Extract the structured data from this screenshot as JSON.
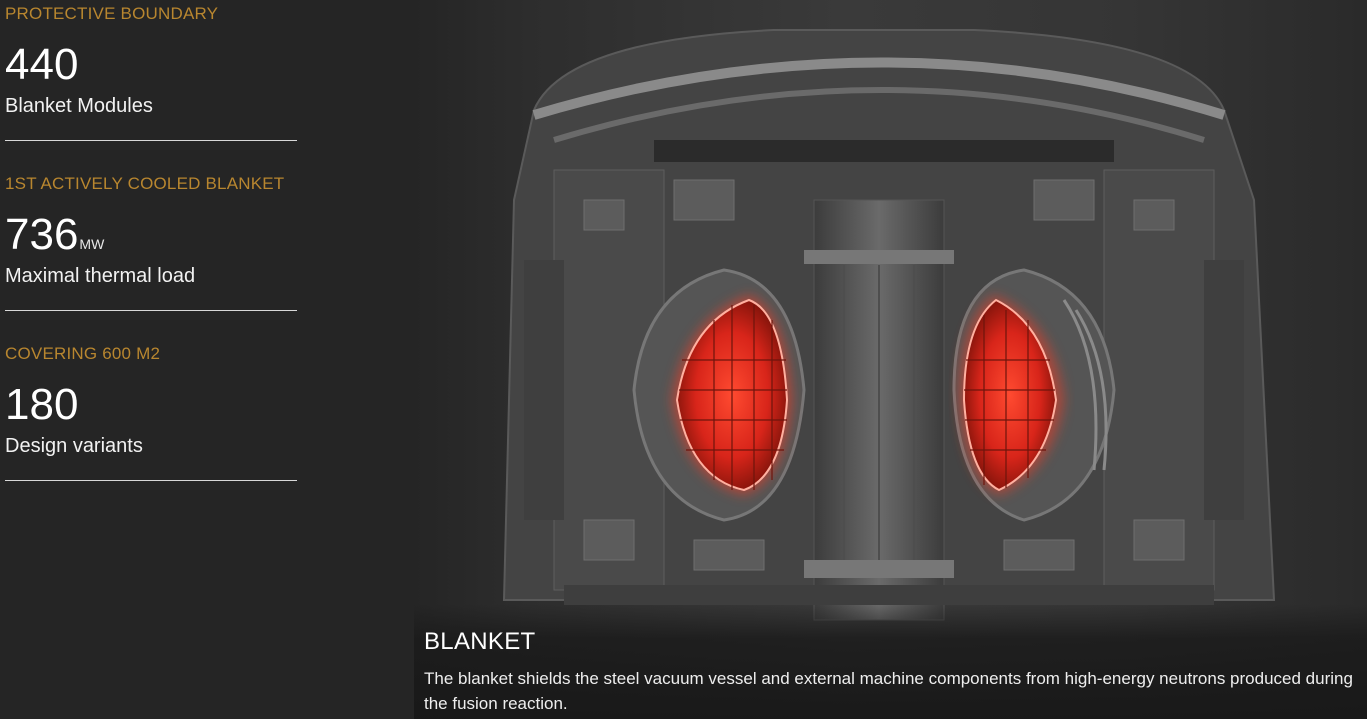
{
  "stats": [
    {
      "kicker": "PROTECTIVE BOUNDARY",
      "value": "440",
      "unit": "",
      "label": "Blanket Modules"
    },
    {
      "kicker": "1ST ACTIVELY COOLED BLANKET",
      "value": "736",
      "unit": "MW",
      "label": "Maximal thermal load"
    },
    {
      "kicker": "COVERING 600 M2",
      "value": "180",
      "unit": "",
      "label": "Design variants"
    }
  ],
  "caption": {
    "title": "BLANKET",
    "body": "The blanket shields the steel vacuum vessel and external machine components from high-energy neutrons produced during the fusion reaction."
  },
  "colors": {
    "background": "#252525",
    "accent": "#b8862f",
    "highlight": "#e8321e"
  },
  "image": {
    "icon": "tokamak-cutaway-illustration"
  }
}
